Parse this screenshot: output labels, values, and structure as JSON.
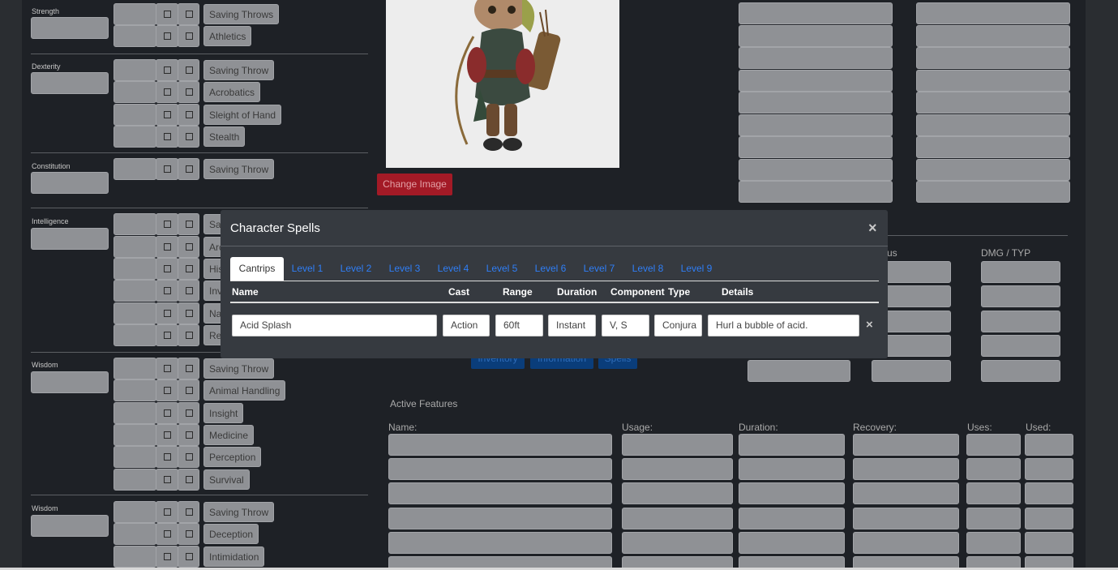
{
  "abilities": [
    {
      "label": "Strength"
    },
    {
      "label": "Dexterity"
    },
    {
      "label": "Constitution"
    },
    {
      "label": "Intelligence"
    },
    {
      "label": "Wisdom"
    },
    {
      "label": "Wisdom"
    }
  ],
  "skills": {
    "strength": [
      "Saving Throws",
      "Athletics"
    ],
    "dexterity": [
      "Saving Throw",
      "Acrobatics",
      "Sleight of Hand",
      "Stealth"
    ],
    "constitution": [
      "Saving Throw"
    ],
    "intelligence": [
      "Sav",
      "Arc",
      "His",
      "Inv",
      "Na",
      "Rel"
    ],
    "wisdom": [
      "Saving Throw",
      "Animal Handling",
      "Insight",
      "Medicine",
      "Perception",
      "Survival"
    ],
    "charisma": [
      "Saving Throw",
      "Deception",
      "Intimidation"
    ]
  },
  "portrait": {
    "change_image_label": "Change Image"
  },
  "attacks": {
    "bonus_label_partial": "us",
    "damage_label": "DMG / TYP"
  },
  "nav_buttons": [
    "Inventory",
    "Information",
    "Spells"
  ],
  "active_features": {
    "title": "Active Features",
    "columns": [
      "Name:",
      "Usage:",
      "Duration:",
      "Recovery:",
      "Uses:",
      "Used:"
    ]
  },
  "modal": {
    "title": "Character Spells",
    "close_label": "×",
    "tabs": [
      "Cantrips",
      "Level 1",
      "Level 2",
      "Level 3",
      "Level 4",
      "Level 5",
      "Level 6",
      "Level 7",
      "Level 8",
      "Level 9"
    ],
    "active_tab": "Cantrips",
    "headers": [
      "Name",
      "Cast",
      "Range",
      "Duration",
      "Component",
      "Type",
      "Details"
    ],
    "spell_row": {
      "name": "Acid Splash",
      "cast": "Action",
      "range": "60ft",
      "duration": "Instant",
      "component": "V, S",
      "type": "Conjura",
      "details": "Hurl a bubble of acid.",
      "delete_label": "×"
    }
  },
  "colors": {
    "accent": "#2f7ef6",
    "danger": "#a31a26",
    "panel": "#363a40",
    "page": "#1e2126"
  }
}
